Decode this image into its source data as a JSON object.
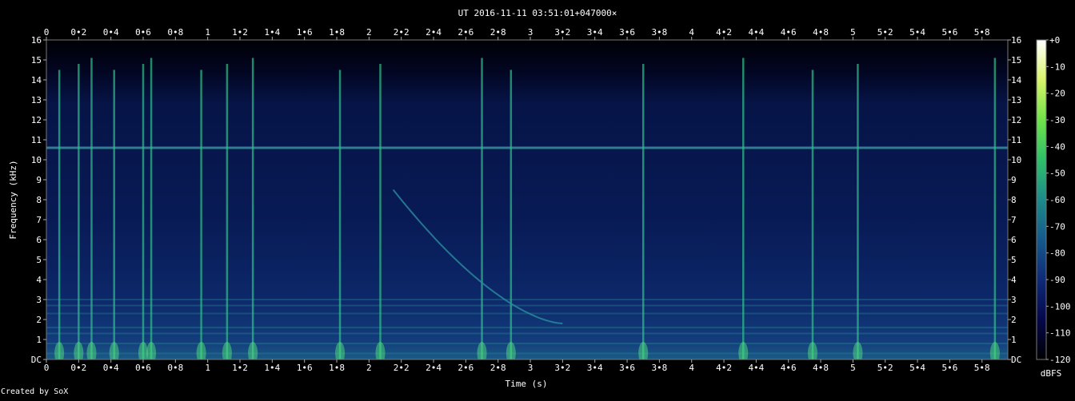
{
  "chart_data": {
    "type": "heatmap",
    "title": "UT 2016-11-11 03:51:01+047000×",
    "xlabel": "Time (s)",
    "ylabel": "Frequency (kHz)",
    "x_range": [
      0,
      5.96
    ],
    "y_range": [
      0,
      16
    ],
    "x_ticks": [
      "0",
      "0•2",
      "0•4",
      "0•6",
      "0•8",
      "1",
      "1•2",
      "1•4",
      "1•6",
      "1•8",
      "2",
      "2•2",
      "2•4",
      "2•6",
      "2•8",
      "3",
      "3•2",
      "3•4",
      "3•6",
      "3•8",
      "4",
      "4•2",
      "4•4",
      "4•6",
      "4•8",
      "5",
      "5•2",
      "5•4",
      "5•6",
      "5•8"
    ],
    "y_ticks": [
      "DC",
      "1",
      "2",
      "3",
      "4",
      "5",
      "6",
      "7",
      "8",
      "9",
      "10",
      "11",
      "12",
      "13",
      "14",
      "15",
      "16"
    ],
    "colorbar": {
      "label": "dBFS",
      "range": [
        -120,
        0
      ],
      "ticks": [
        "+0",
        "-10",
        "-20",
        "-30",
        "-40",
        "-50",
        "-60",
        "-70",
        "-80",
        "-90",
        "-100",
        "-110",
        "-120"
      ],
      "colors": [
        "#000000",
        "#05084a",
        "#0e2a78",
        "#155a8c",
        "#1e8a8a",
        "#2fbf6a",
        "#6fe34a",
        "#d8f46a",
        "#ffffff"
      ]
    },
    "steady_tones_khz": [
      10.6
    ],
    "impulse_events_s": [
      0.08,
      0.2,
      0.28,
      0.42,
      0.6,
      0.65,
      0.96,
      1.12,
      1.28,
      1.82,
      2.07,
      2.7,
      2.88,
      3.7,
      4.32,
      4.75,
      5.03,
      5.88
    ],
    "sweep": {
      "start_s": 2.15,
      "end_s": 3.2,
      "start_khz": 8.5,
      "end_khz": 1.8
    }
  },
  "footer": {
    "credit": "Created by SoX"
  }
}
